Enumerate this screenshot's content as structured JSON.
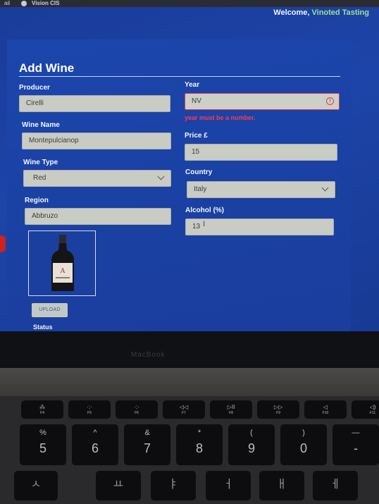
{
  "browser": {
    "os_label": "ail",
    "tab_title": "Vision CIS"
  },
  "header": {
    "welcome_prefix": "Welcome,",
    "user_name": "Vinoted Tasting"
  },
  "form": {
    "title": "Add Wine",
    "producer": {
      "label": "Producer",
      "value": "Cirelli"
    },
    "wine_name": {
      "label": "Wine Name",
      "value": "Montepulcianop"
    },
    "wine_type": {
      "label": "Wine Type",
      "value": "Red"
    },
    "region": {
      "label": "Region",
      "value": "Abbruzo"
    },
    "year": {
      "label": "Year",
      "value": "NV",
      "error": "year must be a number."
    },
    "price": {
      "label": "Price £",
      "value": "15"
    },
    "country": {
      "label": "Country",
      "value": "Italy"
    },
    "alcohol": {
      "label": "Alcohol (%)",
      "value": "13"
    },
    "upload_label": "UPLOAD",
    "status_label": "Status"
  },
  "laptop": {
    "brand": "MacBook",
    "function_keys": [
      {
        "sym": "⁂",
        "cap": "F4"
      },
      {
        "sym": "·:·",
        "cap": "F5"
      },
      {
        "sym": "·:·",
        "cap": "F6"
      },
      {
        "sym": "◁◁",
        "cap": "F7"
      },
      {
        "sym": "▷II",
        "cap": "F8"
      },
      {
        "sym": "▷▷",
        "cap": "F9"
      },
      {
        "sym": "◁",
        "cap": "F10"
      },
      {
        "sym": "◁)",
        "cap": "F11"
      }
    ],
    "number_keys": [
      {
        "top": "%",
        "bot": "5"
      },
      {
        "top": "^",
        "bot": "6"
      },
      {
        "top": "&",
        "bot": "7"
      },
      {
        "top": "*",
        "bot": "8"
      },
      {
        "top": "(",
        "bot": "9"
      },
      {
        "top": ")",
        "bot": "0"
      },
      {
        "top": "—",
        "bot": "-"
      }
    ]
  },
  "colors": {
    "accent_user": "#9be28f",
    "error": "#e23a48",
    "screen_bg": "#1c46ad"
  }
}
